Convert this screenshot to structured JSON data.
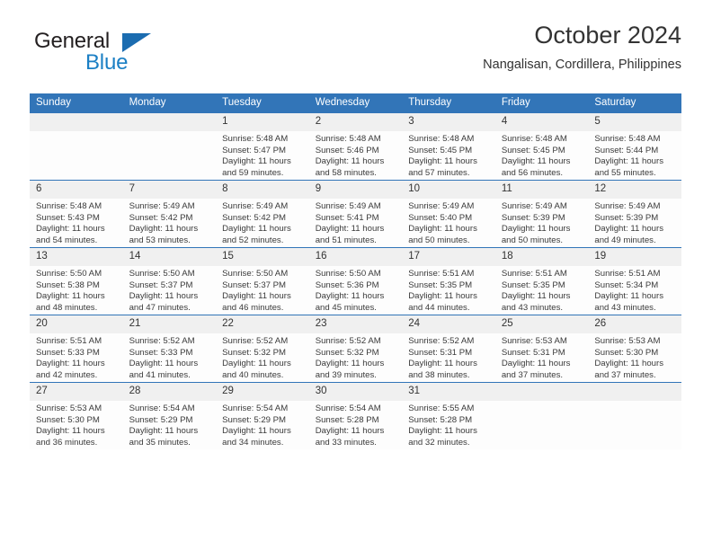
{
  "logo": {
    "word_one": "General",
    "word_two": "Blue",
    "triangle_icon": "triangle-icon"
  },
  "header": {
    "title": "October 2024",
    "subtitle": "Nangalisan, Cordillera, Philippines"
  },
  "colors": {
    "header_blue": "#3275b8",
    "logo_blue": "#1b7fc4",
    "daynum_gray": "#f0f0f0",
    "text": "#333333"
  },
  "weekday_headers": [
    "Sunday",
    "Monday",
    "Tuesday",
    "Wednesday",
    "Thursday",
    "Friday",
    "Saturday"
  ],
  "weeks": [
    [
      {
        "day": "",
        "sunrise": "",
        "sunset": "",
        "daylight_line1": "",
        "daylight_line2": ""
      },
      {
        "day": "",
        "sunrise": "",
        "sunset": "",
        "daylight_line1": "",
        "daylight_line2": ""
      },
      {
        "day": "1",
        "sunrise": "Sunrise: 5:48 AM",
        "sunset": "Sunset: 5:47 PM",
        "daylight_line1": "Daylight: 11 hours",
        "daylight_line2": "and 59 minutes."
      },
      {
        "day": "2",
        "sunrise": "Sunrise: 5:48 AM",
        "sunset": "Sunset: 5:46 PM",
        "daylight_line1": "Daylight: 11 hours",
        "daylight_line2": "and 58 minutes."
      },
      {
        "day": "3",
        "sunrise": "Sunrise: 5:48 AM",
        "sunset": "Sunset: 5:45 PM",
        "daylight_line1": "Daylight: 11 hours",
        "daylight_line2": "and 57 minutes."
      },
      {
        "day": "4",
        "sunrise": "Sunrise: 5:48 AM",
        "sunset": "Sunset: 5:45 PM",
        "daylight_line1": "Daylight: 11 hours",
        "daylight_line2": "and 56 minutes."
      },
      {
        "day": "5",
        "sunrise": "Sunrise: 5:48 AM",
        "sunset": "Sunset: 5:44 PM",
        "daylight_line1": "Daylight: 11 hours",
        "daylight_line2": "and 55 minutes."
      }
    ],
    [
      {
        "day": "6",
        "sunrise": "Sunrise: 5:48 AM",
        "sunset": "Sunset: 5:43 PM",
        "daylight_line1": "Daylight: 11 hours",
        "daylight_line2": "and 54 minutes."
      },
      {
        "day": "7",
        "sunrise": "Sunrise: 5:49 AM",
        "sunset": "Sunset: 5:42 PM",
        "daylight_line1": "Daylight: 11 hours",
        "daylight_line2": "and 53 minutes."
      },
      {
        "day": "8",
        "sunrise": "Sunrise: 5:49 AM",
        "sunset": "Sunset: 5:42 PM",
        "daylight_line1": "Daylight: 11 hours",
        "daylight_line2": "and 52 minutes."
      },
      {
        "day": "9",
        "sunrise": "Sunrise: 5:49 AM",
        "sunset": "Sunset: 5:41 PM",
        "daylight_line1": "Daylight: 11 hours",
        "daylight_line2": "and 51 minutes."
      },
      {
        "day": "10",
        "sunrise": "Sunrise: 5:49 AM",
        "sunset": "Sunset: 5:40 PM",
        "daylight_line1": "Daylight: 11 hours",
        "daylight_line2": "and 50 minutes."
      },
      {
        "day": "11",
        "sunrise": "Sunrise: 5:49 AM",
        "sunset": "Sunset: 5:39 PM",
        "daylight_line1": "Daylight: 11 hours",
        "daylight_line2": "and 50 minutes."
      },
      {
        "day": "12",
        "sunrise": "Sunrise: 5:49 AM",
        "sunset": "Sunset: 5:39 PM",
        "daylight_line1": "Daylight: 11 hours",
        "daylight_line2": "and 49 minutes."
      }
    ],
    [
      {
        "day": "13",
        "sunrise": "Sunrise: 5:50 AM",
        "sunset": "Sunset: 5:38 PM",
        "daylight_line1": "Daylight: 11 hours",
        "daylight_line2": "and 48 minutes."
      },
      {
        "day": "14",
        "sunrise": "Sunrise: 5:50 AM",
        "sunset": "Sunset: 5:37 PM",
        "daylight_line1": "Daylight: 11 hours",
        "daylight_line2": "and 47 minutes."
      },
      {
        "day": "15",
        "sunrise": "Sunrise: 5:50 AM",
        "sunset": "Sunset: 5:37 PM",
        "daylight_line1": "Daylight: 11 hours",
        "daylight_line2": "and 46 minutes."
      },
      {
        "day": "16",
        "sunrise": "Sunrise: 5:50 AM",
        "sunset": "Sunset: 5:36 PM",
        "daylight_line1": "Daylight: 11 hours",
        "daylight_line2": "and 45 minutes."
      },
      {
        "day": "17",
        "sunrise": "Sunrise: 5:51 AM",
        "sunset": "Sunset: 5:35 PM",
        "daylight_line1": "Daylight: 11 hours",
        "daylight_line2": "and 44 minutes."
      },
      {
        "day": "18",
        "sunrise": "Sunrise: 5:51 AM",
        "sunset": "Sunset: 5:35 PM",
        "daylight_line1": "Daylight: 11 hours",
        "daylight_line2": "and 43 minutes."
      },
      {
        "day": "19",
        "sunrise": "Sunrise: 5:51 AM",
        "sunset": "Sunset: 5:34 PM",
        "daylight_line1": "Daylight: 11 hours",
        "daylight_line2": "and 43 minutes."
      }
    ],
    [
      {
        "day": "20",
        "sunrise": "Sunrise: 5:51 AM",
        "sunset": "Sunset: 5:33 PM",
        "daylight_line1": "Daylight: 11 hours",
        "daylight_line2": "and 42 minutes."
      },
      {
        "day": "21",
        "sunrise": "Sunrise: 5:52 AM",
        "sunset": "Sunset: 5:33 PM",
        "daylight_line1": "Daylight: 11 hours",
        "daylight_line2": "and 41 minutes."
      },
      {
        "day": "22",
        "sunrise": "Sunrise: 5:52 AM",
        "sunset": "Sunset: 5:32 PM",
        "daylight_line1": "Daylight: 11 hours",
        "daylight_line2": "and 40 minutes."
      },
      {
        "day": "23",
        "sunrise": "Sunrise: 5:52 AM",
        "sunset": "Sunset: 5:32 PM",
        "daylight_line1": "Daylight: 11 hours",
        "daylight_line2": "and 39 minutes."
      },
      {
        "day": "24",
        "sunrise": "Sunrise: 5:52 AM",
        "sunset": "Sunset: 5:31 PM",
        "daylight_line1": "Daylight: 11 hours",
        "daylight_line2": "and 38 minutes."
      },
      {
        "day": "25",
        "sunrise": "Sunrise: 5:53 AM",
        "sunset": "Sunset: 5:31 PM",
        "daylight_line1": "Daylight: 11 hours",
        "daylight_line2": "and 37 minutes."
      },
      {
        "day": "26",
        "sunrise": "Sunrise: 5:53 AM",
        "sunset": "Sunset: 5:30 PM",
        "daylight_line1": "Daylight: 11 hours",
        "daylight_line2": "and 37 minutes."
      }
    ],
    [
      {
        "day": "27",
        "sunrise": "Sunrise: 5:53 AM",
        "sunset": "Sunset: 5:30 PM",
        "daylight_line1": "Daylight: 11 hours",
        "daylight_line2": "and 36 minutes."
      },
      {
        "day": "28",
        "sunrise": "Sunrise: 5:54 AM",
        "sunset": "Sunset: 5:29 PM",
        "daylight_line1": "Daylight: 11 hours",
        "daylight_line2": "and 35 minutes."
      },
      {
        "day": "29",
        "sunrise": "Sunrise: 5:54 AM",
        "sunset": "Sunset: 5:29 PM",
        "daylight_line1": "Daylight: 11 hours",
        "daylight_line2": "and 34 minutes."
      },
      {
        "day": "30",
        "sunrise": "Sunrise: 5:54 AM",
        "sunset": "Sunset: 5:28 PM",
        "daylight_line1": "Daylight: 11 hours",
        "daylight_line2": "and 33 minutes."
      },
      {
        "day": "31",
        "sunrise": "Sunrise: 5:55 AM",
        "sunset": "Sunset: 5:28 PM",
        "daylight_line1": "Daylight: 11 hours",
        "daylight_line2": "and 32 minutes."
      },
      {
        "day": "",
        "sunrise": "",
        "sunset": "",
        "daylight_line1": "",
        "daylight_line2": ""
      },
      {
        "day": "",
        "sunrise": "",
        "sunset": "",
        "daylight_line1": "",
        "daylight_line2": ""
      }
    ]
  ]
}
